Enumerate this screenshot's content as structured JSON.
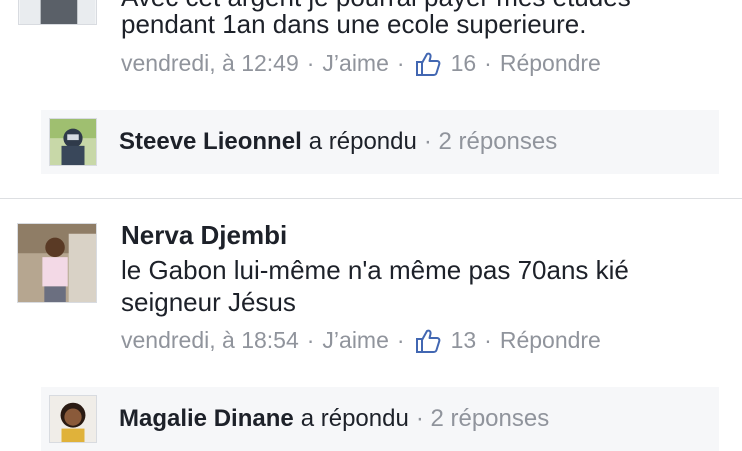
{
  "comment1": {
    "text_line0": "Avec cet argent je pourrai payer mes études",
    "text_line1": "pendant 1an dans une ecole superieure.",
    "meta": {
      "time": "vendredi, à 12:49",
      "like_label": "J’aime",
      "like_count": "16",
      "reply_label": "Répondre"
    },
    "reply_summary": {
      "name": "Steeve Lieonnel",
      "action": "a répondu",
      "count": "· 2 réponses"
    }
  },
  "comment2": {
    "author": "Nerva Djembi",
    "text_line1": "le Gabon lui-même n'a même pas 70ans kié",
    "text_line2": "seigneur Jésus",
    "meta": {
      "time": "vendredi, à 18:54",
      "like_label": "J’aime",
      "like_count": "13",
      "reply_label": "Répondre"
    },
    "reply_summary": {
      "name": "Magalie Dinane",
      "action": "a répondu",
      "count": "· 2 réponses"
    }
  },
  "separator": "·",
  "colors": {
    "text": "#1d2129",
    "meta": "#90949c",
    "reply_bg": "#f6f7f9",
    "divider": "#dddfe2",
    "like_icon": "#4267b2"
  },
  "icons": {
    "like": "thumbs-up-icon"
  }
}
